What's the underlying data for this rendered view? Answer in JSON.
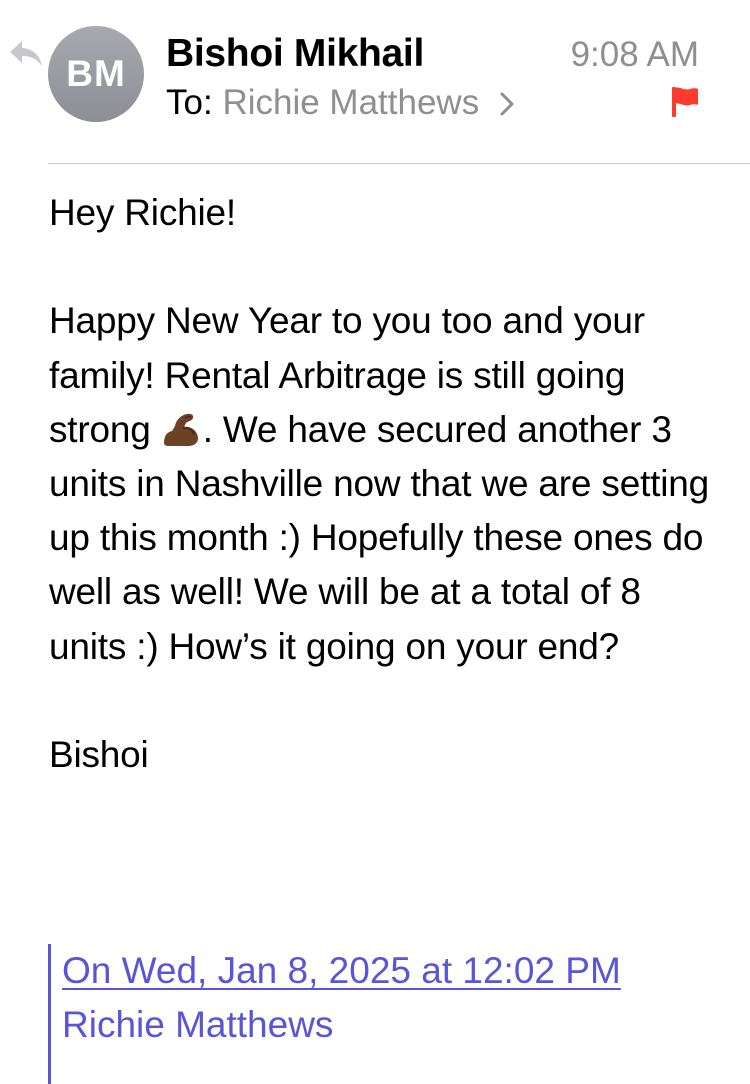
{
  "header": {
    "avatar_initials": "BM",
    "sender_name": "Bishoi Mikhail",
    "time": "9:08 AM",
    "to_prefix": "To:",
    "recipient": "Richie Matthews",
    "flag_color": "#ff3b30",
    "icons": {
      "reply": "reply-arrow-icon",
      "chevron": "chevron-right-icon",
      "flag": "flag-icon"
    }
  },
  "body": {
    "greeting": "Hey Richie!",
    "paragraph_part1": "Happy New Year to you too and your family! Rental Arbitrage is still going strong ",
    "emoji": "flexed-biceps-emoji",
    "paragraph_part2": ". We have secured another 3 units in Nashville now that we are setting up this month :) Hopefully these ones do well as well! We will be at a total of 8 units :) How’s it going on your end?",
    "signature": "Bishoi"
  },
  "quote": {
    "header_link": "On Wed, Jan 8, 2025 at 12:02 PM",
    "author": "Richie Matthews",
    "accent_color": "#5856d6"
  }
}
